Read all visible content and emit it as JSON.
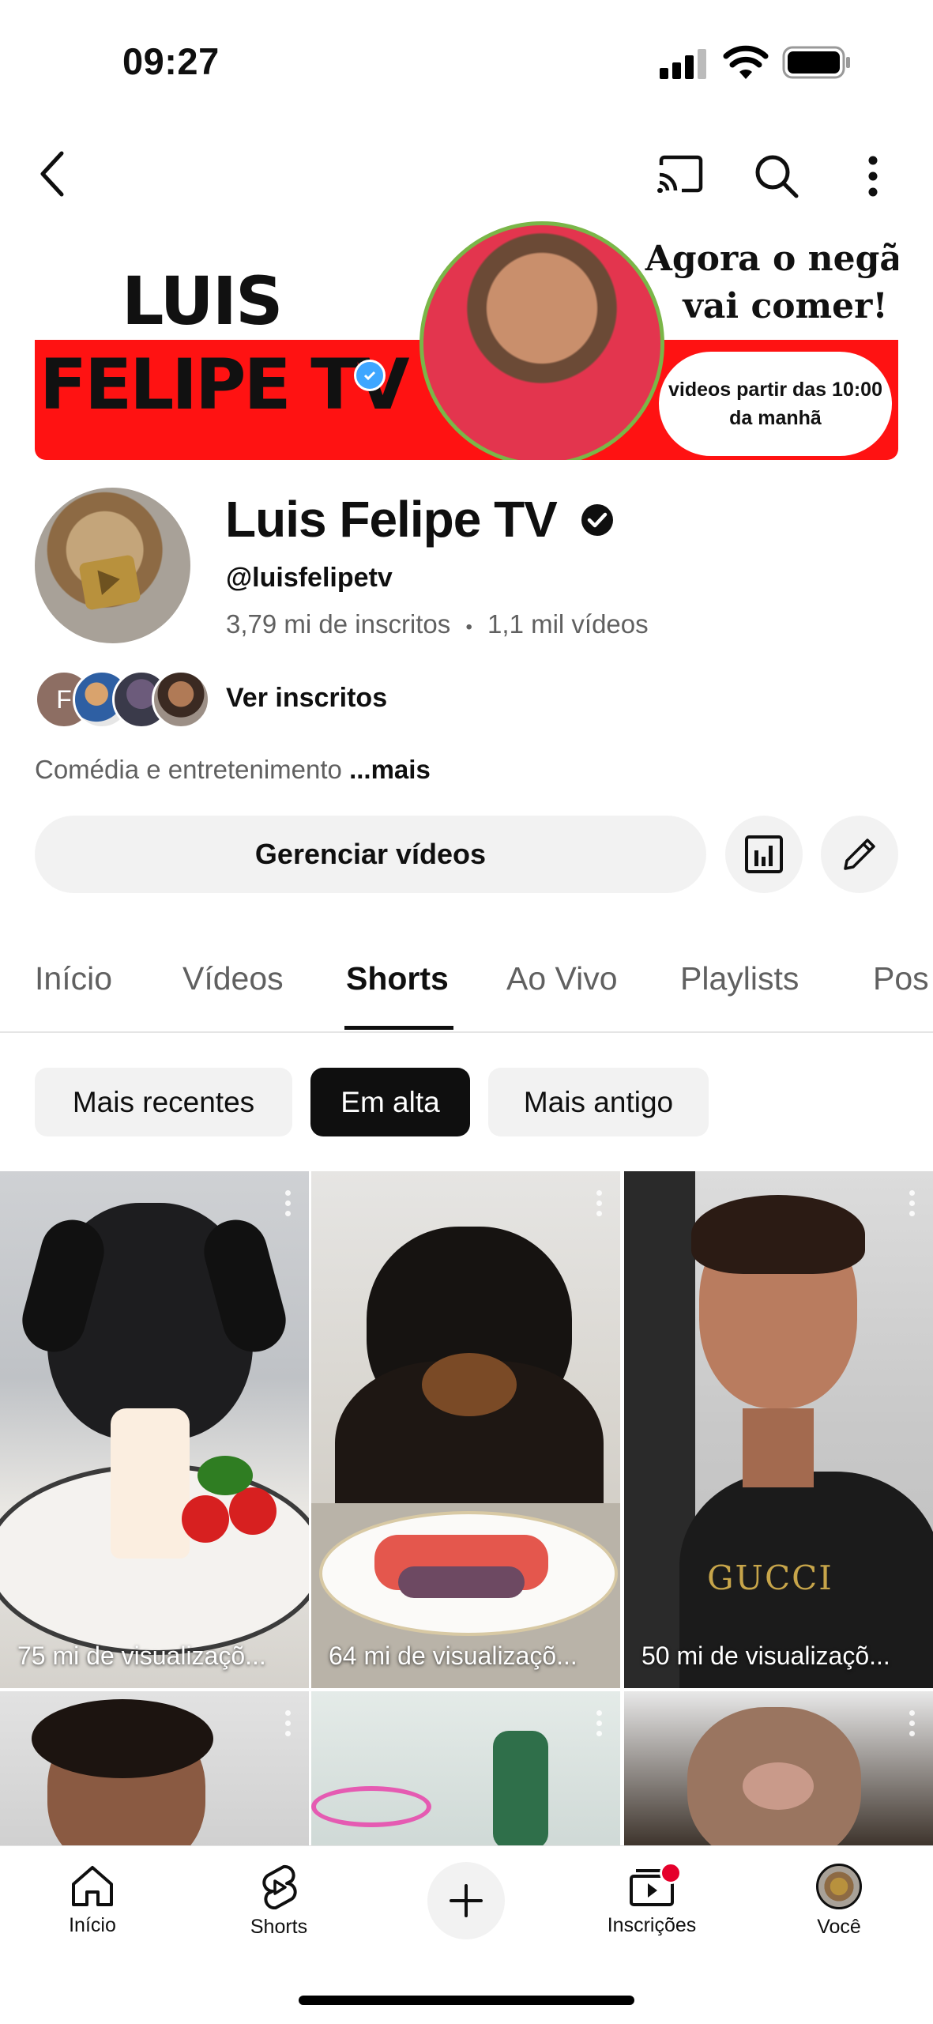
{
  "status_bar": {
    "time": "09:27"
  },
  "banner": {
    "title_line1": "LUIS",
    "title_line2": "FELIPE TV",
    "quote": "Agora o negão vai comer!",
    "schedule": "videos partir das 10:00 da manhã"
  },
  "channel": {
    "name": "Luis Felipe TV",
    "handle": "@luisfelipetv",
    "subscribers": "3,79 mi de inscritos",
    "separator": "•",
    "videos": "1,1 mil vídeos",
    "subscriber_initial": "F",
    "view_subscribers_label": "Ver inscritos",
    "category": "Comédia e entretenimento",
    "more_label": "...mais"
  },
  "actions": {
    "manage_label": "Gerenciar vídeos"
  },
  "tabs": [
    {
      "label": "Início"
    },
    {
      "label": "Vídeos"
    },
    {
      "label": "Shorts"
    },
    {
      "label": "Ao Vivo"
    },
    {
      "label": "Playlists"
    },
    {
      "label": "Pos"
    }
  ],
  "active_tab": "Shorts",
  "filters": [
    {
      "label": "Mais recentes"
    },
    {
      "label": "Em alta"
    },
    {
      "label": "Mais antigo"
    }
  ],
  "active_filter": "Em alta",
  "shorts": [
    {
      "views": "75 mi de visualizaçõ..."
    },
    {
      "views": "64 mi de visualizaçõ..."
    },
    {
      "views": "50 mi de visualizaçõ..."
    }
  ],
  "bottom_nav": [
    {
      "label": "Início",
      "icon": "home-icon"
    },
    {
      "label": "Shorts",
      "icon": "shorts-icon"
    },
    {
      "label": "",
      "icon": "create-icon"
    },
    {
      "label": "Inscrições",
      "icon": "subscriptions-icon"
    },
    {
      "label": "Você",
      "icon": "profile-avatar"
    }
  ],
  "colors": {
    "accent_red": "#ff1212",
    "verified_blue": "#3ea6ff"
  }
}
